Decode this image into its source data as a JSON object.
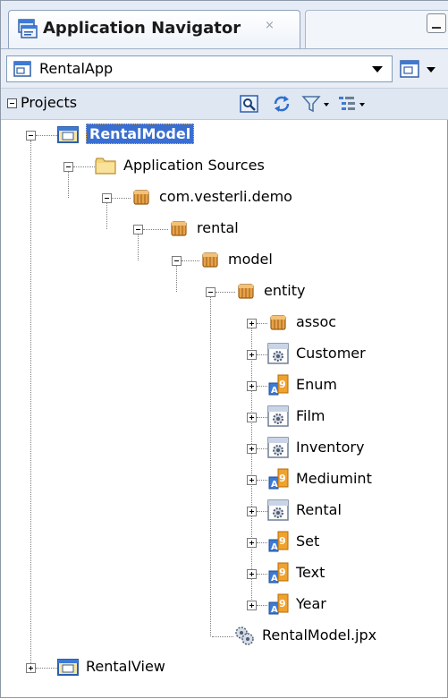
{
  "tab": {
    "title": "Application Navigator",
    "close": "×"
  },
  "app_selector": {
    "value": "RentalApp"
  },
  "projects": {
    "label": "Projects"
  },
  "tree": [
    {
      "label": "RentalModel",
      "icon": "project-folder-icon",
      "expanded": true,
      "selected": true
    },
    {
      "label": "Application Sources",
      "icon": "folder-icon",
      "expanded": true
    },
    {
      "label": "com.vesterli.demo",
      "icon": "package-icon",
      "expanded": true
    },
    {
      "label": "rental",
      "icon": "package-icon",
      "expanded": true
    },
    {
      "label": "model",
      "icon": "package-icon",
      "expanded": true
    },
    {
      "label": "entity",
      "icon": "package-icon",
      "expanded": true
    },
    {
      "label": "assoc",
      "icon": "package-icon",
      "expanded": false
    },
    {
      "label": "Customer",
      "icon": "entity-object-icon",
      "expanded": false
    },
    {
      "label": "Enum",
      "icon": "domain-icon",
      "expanded": false
    },
    {
      "label": "Film",
      "icon": "entity-object-icon",
      "expanded": false
    },
    {
      "label": "Inventory",
      "icon": "entity-object-icon",
      "expanded": false
    },
    {
      "label": "Mediumint",
      "icon": "domain-icon",
      "expanded": false
    },
    {
      "label": "Rental",
      "icon": "entity-object-icon",
      "expanded": false
    },
    {
      "label": "Set",
      "icon": "domain-icon",
      "expanded": false
    },
    {
      "label": "Text",
      "icon": "domain-icon",
      "expanded": false
    },
    {
      "label": "Year",
      "icon": "domain-icon",
      "expanded": false
    },
    {
      "label": "RentalModel.jpx",
      "icon": "model-project-file-icon"
    },
    {
      "label": "RentalView",
      "icon": "project-folder-icon",
      "expanded": false
    }
  ]
}
